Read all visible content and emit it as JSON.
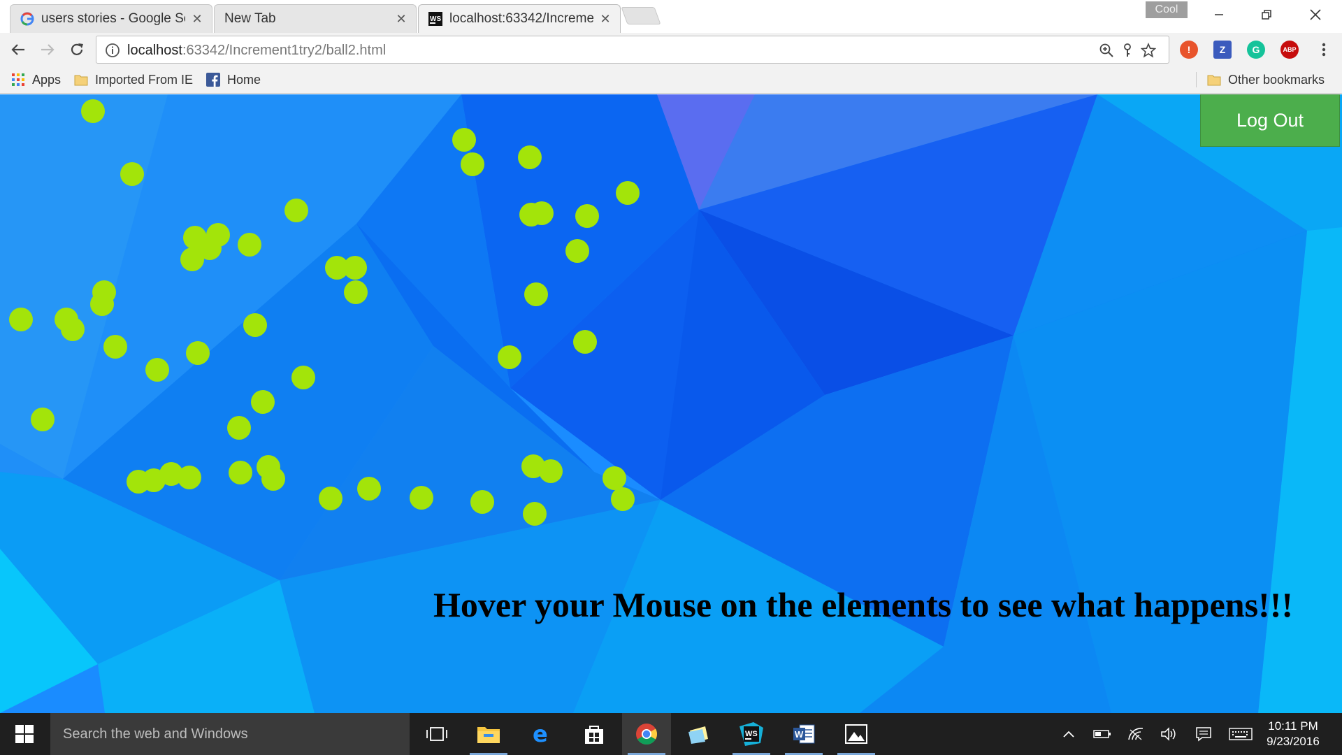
{
  "browser": {
    "tabs": [
      {
        "title": "users stories - Google Se",
        "icon": "google-icon",
        "active": false
      },
      {
        "title": "New Tab",
        "icon": "none",
        "active": false
      },
      {
        "title": "localhost:63342/Increme",
        "icon": "webstorm-icon",
        "active": true
      }
    ],
    "profile_badge": "Cool",
    "url_host": "localhost",
    "url_rest": ":63342/Increment1try2/ball2.html",
    "bookmarks": [
      {
        "label": "Apps",
        "icon": "apps-grid-icon"
      },
      {
        "label": "Imported From IE",
        "icon": "folder-icon"
      },
      {
        "label": "Home",
        "icon": "facebook-icon"
      }
    ],
    "other_bookmarks": "Other bookmarks"
  },
  "page": {
    "logout_label": "Log Out",
    "hover_message": "Hover your Mouse on the elements to see what happens!!!",
    "ball_color": "#a3e40a",
    "logout_color": "#4cae4c",
    "ball_count": 56
  },
  "taskbar": {
    "search_placeholder": "Search the web and Windows",
    "apps": [
      "task-view-icon",
      "file-explorer-icon",
      "edge-icon",
      "store-icon",
      "chrome-icon",
      "sticky-notes-icon",
      "webstorm-icon",
      "word-icon",
      "photos-icon"
    ],
    "time": "10:11 PM",
    "date": "9/23/2016"
  }
}
